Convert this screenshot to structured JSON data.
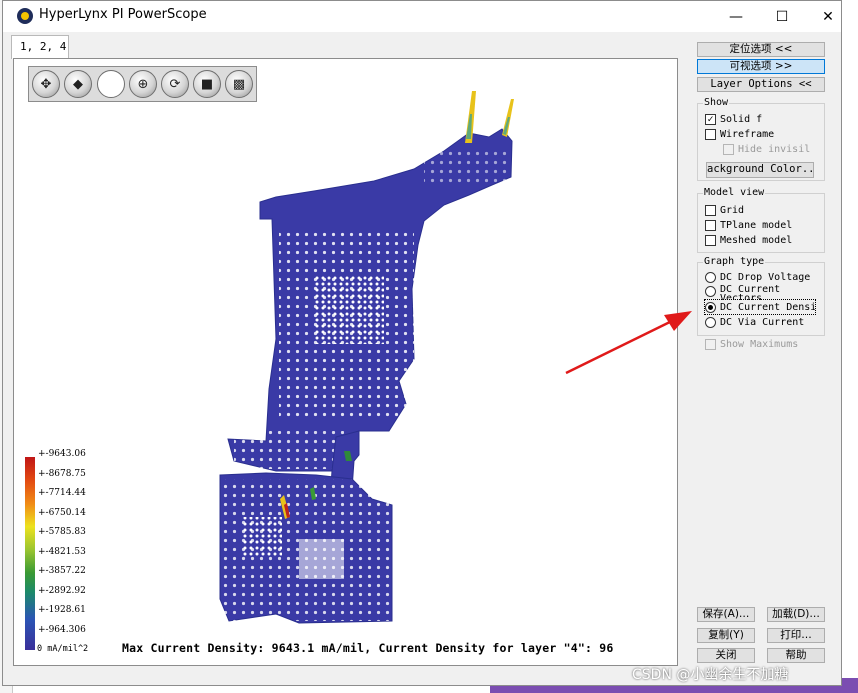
{
  "window": {
    "title": "HyperLynx PI PowerScope"
  },
  "tabs": [
    {
      "label": "1, 2, 4"
    }
  ],
  "panel": {
    "location_options": "定位选项 <<",
    "visual_options": "可视选项 >>",
    "layer_options": "Layer Options <<",
    "show": {
      "title": "Show",
      "solid": "Solid f",
      "wireframe": "Wireframe",
      "hide_invisible": "Hide invisil",
      "background_color": "ackground Color.."
    },
    "model_view": {
      "title": "Model view",
      "grid": "Grid",
      "tplane": "TPlane model",
      "meshed": "Meshed model"
    },
    "graph_type": {
      "title": "Graph type",
      "options": [
        "DC Drop Voltage",
        "DC Current Vectors",
        "DC Current Densi",
        "DC Via Current"
      ],
      "selected": "DC Current Densi"
    },
    "show_maximums": "Show Maximums"
  },
  "bottom_buttons": {
    "save": "保存(A)…",
    "load": "加载(D)…",
    "copy": "复制(Y)",
    "print": "打印…",
    "close": "关闭",
    "help": "帮助"
  },
  "legend": {
    "labels": [
      "+-9643.06",
      "+-8678.75",
      "+-7714.44",
      "+-6750.14",
      "+-5785.83",
      "+-4821.53",
      "+-3857.22",
      "+-2892.92",
      "+-1928.61",
      "+-964.306",
      "0 mA/mil^2"
    ],
    "colors": {
      "max": "#c01616",
      "mid": "#ede21e",
      "min": "#3a2f9a"
    }
  },
  "status_line": "Max Current Density: 9643.1 mA/mil, Current Density for layer \"4\": 96",
  "watermark": "CSDN @小幽余生不加糖",
  "icons": [
    "app-icon",
    "minimize-icon",
    "maximize-icon",
    "close-icon",
    "pan-icon",
    "move-icon",
    "zoom-icon",
    "target-icon",
    "rotate-icon",
    "stop-icon",
    "fit-icon"
  ],
  "plot_colors": {
    "plane": "#3a3aa6",
    "edge": "#2a2f8f",
    "spike_warm": "#e8c21a"
  }
}
